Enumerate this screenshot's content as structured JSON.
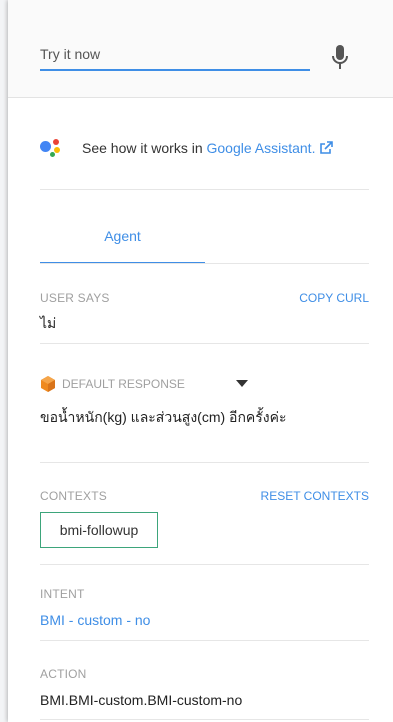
{
  "try_it": {
    "placeholder": "Try it now",
    "icon": "microphone-icon"
  },
  "assistant": {
    "prefix": "See how it works in",
    "link": "Google Assistant",
    "suffix": ".",
    "logo_colors": [
      "#4285f4",
      "#ea4335",
      "#fbbc05",
      "#34a853"
    ]
  },
  "tabs": [
    {
      "label": "Agent",
      "active": true
    }
  ],
  "user_says": {
    "label": "USER SAYS",
    "action": "COPY CURL",
    "value": "ไม่"
  },
  "response": {
    "label": "DEFAULT RESPONSE",
    "value": "ขอน้ำหนัก(kg) และส่วนสูง(cm) อีกครั้งค่ะ"
  },
  "contexts": {
    "label": "CONTEXTS",
    "action": "RESET CONTEXTS",
    "items": [
      "bmi-followup"
    ]
  },
  "intent": {
    "label": "INTENT",
    "value": "BMI - custom - no"
  },
  "action": {
    "label": "ACTION",
    "value": "BMI.BMI-custom.BMI-custom-no"
  },
  "colors": {
    "accent": "#3f8ee6",
    "chip_border": "#3da57b",
    "label": "#a0a0a0"
  }
}
